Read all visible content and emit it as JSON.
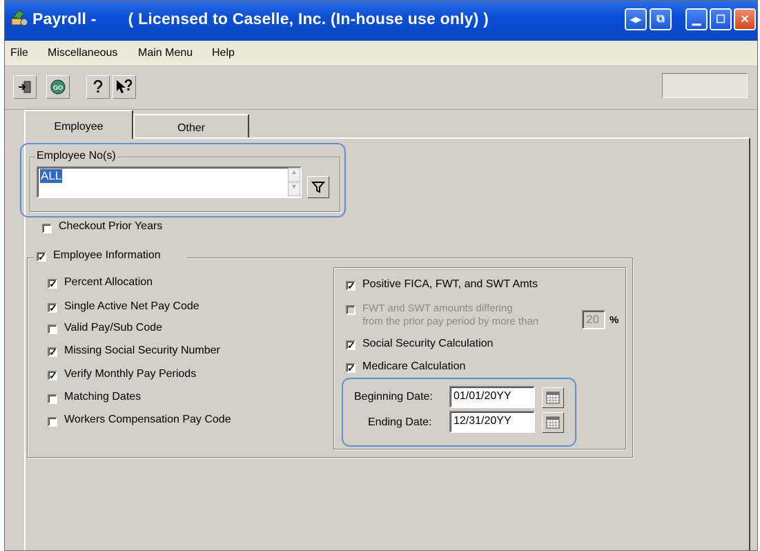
{
  "window": {
    "title": "Payroll -       ( Licensed to Caselle, Inc. (In-house use only) )",
    "buttons": [
      "restore-aux",
      "popout",
      "minimize",
      "maximize",
      "close"
    ]
  },
  "menu": {
    "items": [
      "File",
      "Miscellaneous",
      "Main Menu",
      "Help"
    ]
  },
  "toolbar": {
    "icons": [
      "exit-icon",
      "go-icon",
      "help-icon",
      "whats-this-icon"
    ]
  },
  "tabs": [
    {
      "label": "Employee",
      "active": true
    },
    {
      "label": "Other",
      "active": false
    }
  ],
  "employee_nos": {
    "legend": "Employee No(s)",
    "value": "ALL"
  },
  "checkout_prior_years": {
    "label": "Checkout Prior Years",
    "checked": false
  },
  "employee_information": {
    "label": "Employee Information",
    "checked": true,
    "items": [
      {
        "label": "Percent Allocation",
        "checked": true
      },
      {
        "label": "Single Active Net Pay Code",
        "checked": true
      },
      {
        "label": "Valid Pay/Sub Code",
        "checked": false
      },
      {
        "label": "Missing Social Security Number",
        "checked": true
      },
      {
        "label": "Verify Monthly Pay Periods",
        "checked": true
      },
      {
        "label": "Matching Dates",
        "checked": false
      },
      {
        "label": "Workers Compensation Pay Code",
        "checked": false
      }
    ]
  },
  "tax_checks": {
    "positive_fica": {
      "label": "Positive FICA, FWT, and SWT Amts",
      "checked": true
    },
    "fwt_swt_diff": {
      "line1": "FWT and SWT amounts differing",
      "line2": "from the prior pay period by more than",
      "percent": "20",
      "percent_symbol": "%",
      "checked": false,
      "disabled": true
    },
    "social_security": {
      "label": "Social Security Calculation",
      "checked": true
    },
    "medicare": {
      "label": "Medicare Calculation",
      "checked": true
    },
    "beginning_date": {
      "label": "Beginning Date:",
      "value": "01/01/20YY"
    },
    "ending_date": {
      "label": "Ending Date:",
      "value": "12/31/20YY"
    }
  },
  "colors": {
    "title_bar": "#0a4fd6",
    "highlight": "#5b8fd9",
    "dialog_face": "#d4d0c8"
  }
}
